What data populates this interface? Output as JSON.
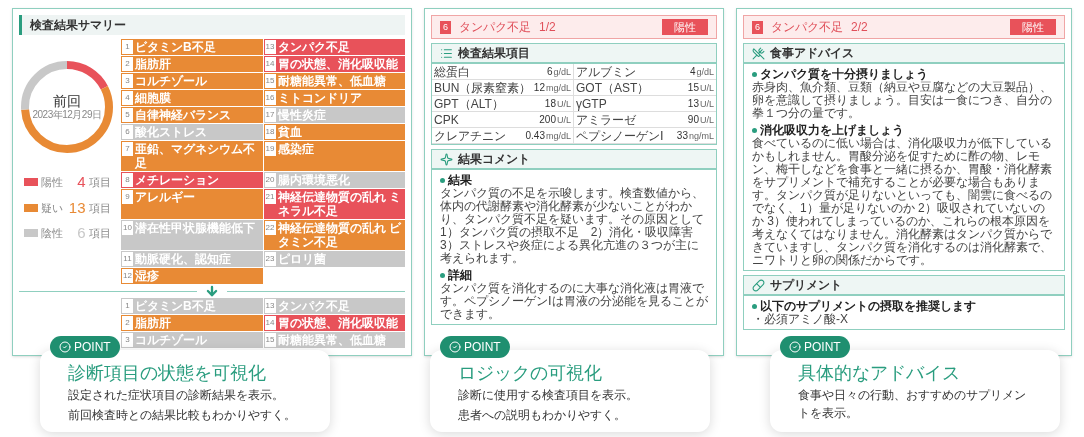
{
  "panels": [
    {
      "kind": "summary",
      "title": "検査結果サマリー",
      "donut": {
        "label": "前回",
        "date": "2023年12月29日"
      },
      "legend": [
        {
          "label": "陽性",
          "count": "4",
          "unit": "項目",
          "color": "#e8525a"
        },
        {
          "label": "疑い",
          "count": "13",
          "unit": "項目",
          "color": "#e88a35"
        },
        {
          "label": "陰性",
          "count": "6",
          "unit": "項目",
          "color": "#c8c8c8"
        }
      ],
      "items": [
        {
          "number": "1",
          "label": "ビタミンB不足",
          "color": "#e88a35"
        },
        {
          "number": "13",
          "label": "タンパク不足",
          "color": "#e8525a"
        },
        {
          "number": "2",
          "label": "脂肪肝",
          "color": "#e88a35"
        },
        {
          "number": "14",
          "label": "胃の状態、消化吸収能",
          "color": "#e8525a"
        },
        {
          "number": "3",
          "label": "コルチゾール",
          "color": "#e88a35"
        },
        {
          "number": "15",
          "label": "耐糖能異常、低血糖",
          "color": "#e88a35"
        },
        {
          "number": "4",
          "label": "細胞膜",
          "color": "#e88a35"
        },
        {
          "number": "16",
          "label": "ミトコンドリア",
          "color": "#e88a35"
        },
        {
          "number": "5",
          "label": "自律神経バランス",
          "color": "#e88a35"
        },
        {
          "number": "17",
          "label": "慢性炎症",
          "color": "#c8c8c8"
        },
        {
          "number": "6",
          "label": "酸化ストレス",
          "color": "#c8c8c8"
        },
        {
          "number": "18",
          "label": "貧血",
          "color": "#e88a35"
        },
        {
          "number": "7",
          "label": "亜鉛、マグネシウム不足",
          "color": "#e88a35"
        },
        {
          "number": "19",
          "label": "感染症",
          "color": "#e88a35"
        },
        {
          "number": "8",
          "label": "メチレーション",
          "color": "#e8525a"
        },
        {
          "number": "20",
          "label": "腸内環境悪化",
          "color": "#c8c8c8"
        },
        {
          "number": "9",
          "label": "アレルギー",
          "color": "#e88a35"
        },
        {
          "number": "21",
          "label": "神経伝達物質の乱れ ミネラル不足",
          "color": "#e8525a"
        },
        {
          "number": "10",
          "label": "潜在性甲状腺機能低下",
          "color": "#c8c8c8"
        },
        {
          "number": "22",
          "label": "神経伝達物質の乱れ ビタミン不足",
          "color": "#e88a35"
        },
        {
          "number": "11",
          "label": "動脈硬化、認知症",
          "color": "#c8c8c8"
        },
        {
          "number": "23",
          "label": "ピロリ菌",
          "color": "#c8c8c8"
        },
        {
          "number": "12",
          "label": "湿疹",
          "color": "#e88a35"
        }
      ],
      "current_items": [
        {
          "number": "1",
          "label": "ビタミンB不足",
          "color": "#c8c8c8"
        },
        {
          "number": "13",
          "label": "タンパク不足",
          "color": "#c8c8c8"
        },
        {
          "number": "2",
          "label": "脂肪肝",
          "color": "#e88a35"
        },
        {
          "number": "14",
          "label": "胃の状態、消化吸収能",
          "color": "#e8525a"
        },
        {
          "number": "3",
          "label": "コルチゾール",
          "color": "#c8c8c8"
        },
        {
          "number": "15",
          "label": "耐糖能異常、低血糖",
          "color": "#c8c8c8"
        }
      ]
    },
    {
      "kind": "logic",
      "header": {
        "number": "6",
        "title": "タンパク不足",
        "page": "1/2",
        "badge": "陽性"
      },
      "table_title": "検査結果項目",
      "tests": [
        {
          "name": "総蛋白",
          "value": "6",
          "unit": "g/dL"
        },
        {
          "name": "アルブミン",
          "value": "4",
          "unit": "g/dL"
        },
        {
          "name": "BUN（尿素窒素）",
          "value": "12",
          "unit": "mg/dL"
        },
        {
          "name": "GOT（AST）",
          "value": "15",
          "unit": "U/L"
        },
        {
          "name": "GPT（ALT）",
          "value": "18",
          "unit": "U/L"
        },
        {
          "name": "γGTP",
          "value": "13",
          "unit": "U/L"
        },
        {
          "name": "CPK",
          "value": "200",
          "unit": "U/L"
        },
        {
          "name": "アミラーゼ",
          "value": "90",
          "unit": "U/L"
        },
        {
          "name": "クレアチニン",
          "value": "0.43",
          "unit": "mg/dL"
        },
        {
          "name": "ペプシノーゲンⅠ",
          "value": "33",
          "unit": "ng/mL"
        }
      ],
      "comment_title": "結果コメント",
      "comments": [
        {
          "heading": "結果",
          "text": "タンパク質の不足を示唆します。検査数値から、体内の代謝酵素や消化酵素が少ないことがわかり、タンパク質不足を疑います。その原因として1）タンパク質の摂取不足　2）消化・吸収障害　3）ストレスや炎症による異化亢進の３つが主に考えられます。"
        },
        {
          "heading": "詳細",
          "text": "タンパク質を消化するのに大事な消化液は胃液です。ペプシノーゲンⅠは胃液の分泌能を見ることができます。"
        }
      ]
    },
    {
      "kind": "advice",
      "header": {
        "number": "6",
        "title": "タンパク不足",
        "page": "2/2",
        "badge": "陽性"
      },
      "sections": [
        {
          "title": "食事アドバイス",
          "blocks": [
            {
              "heading": "タンパク質を十分摂りましょう",
              "text": "赤身肉、魚介類、豆類（納豆や豆腐などの大豆製品）、卵を意識して摂りましょう。目安は一食につき、自分の拳１つ分の量です。"
            },
            {
              "heading": "消化吸収力を上げましょう",
              "text": "食べているのに低い場合は、消化吸収力が低下しているかもしれません。胃酸分泌を促すために酢の物、レモン、梅干しなどを食事と一緒に摂るか、胃酸・消化酵素をサプリメントで補充することが必要な場合もあります。タンパク質が足りないといっても、闇雲に食べるのでなく、1）量が足りないのか 2）吸収されていないのか 3）使われてしまっているのか、これらの根本原因を考えなくてはなりません。消化酵素はタンパク質からできていますし、タンパク質を消化するのは消化酵素で、ニワトリと卵の関係だからです。"
            }
          ]
        },
        {
          "title": "サプリメント",
          "blocks": [
            {
              "heading": "以下のサプリメントの摂取を推奨します",
              "text": "・必須アミノ酸-X"
            }
          ]
        }
      ]
    }
  ],
  "points": [
    {
      "badge": "POINT",
      "title": "診断項目の状態を可視化",
      "lines": [
        "設定された症状項目の診断結果を表示。",
        "前回検査時との結果比較もわかりやすく。"
      ]
    },
    {
      "badge": "POINT",
      "title": "ロジックの可視化",
      "lines": [
        "診断に使用する検査項目を表示。",
        "患者への説明もわかりやすく。"
      ]
    },
    {
      "badge": "POINT",
      "title": "具体的なアドバイス",
      "lines": [
        "食事や日々の行動、おすすめのサプリメントを表示。"
      ]
    }
  ]
}
